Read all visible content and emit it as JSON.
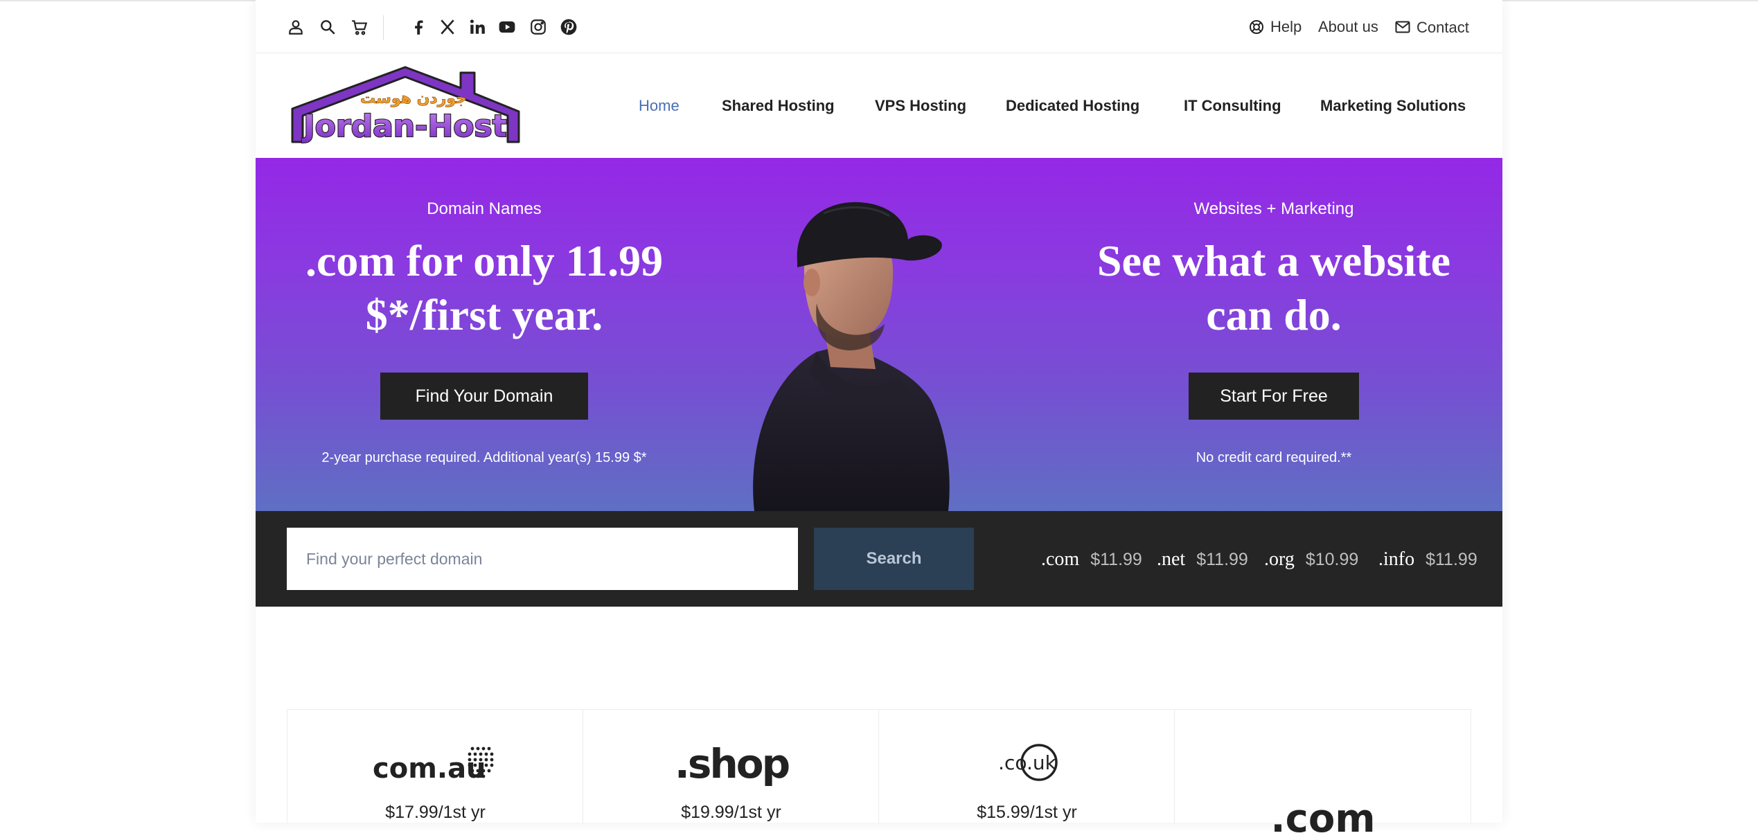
{
  "topbar": {
    "help": "Help",
    "about": "About us",
    "contact": "Contact"
  },
  "logo": {
    "arabic": "جوردن هوست",
    "name": "Jordan-Host"
  },
  "nav": {
    "home": "Home",
    "shared": "Shared Hosting",
    "vps": "VPS Hosting",
    "dedicated": "Dedicated Hosting",
    "consulting": "IT Consulting",
    "marketing": "Marketing Solutions"
  },
  "hero": {
    "left": {
      "eyebrow": "Domain Names",
      "title": ".com for only 11.99 $*/first year.",
      "button": "Find Your Domain",
      "note": "2-year purchase required. Additional year(s) 15.99 $*"
    },
    "right": {
      "eyebrow": "Websites + Marketing",
      "title": "See what a website can do.",
      "button": "Start For Free",
      "note": "No credit card required.**"
    }
  },
  "search": {
    "placeholder": "Find your perfect domain",
    "button": "Search",
    "tlds": [
      {
        "name": ".com",
        "price": "$11.99"
      },
      {
        "name": ".net",
        "price": "$11.99"
      },
      {
        "name": ".org",
        "price": "$10.99"
      },
      {
        "name": ".info",
        "price": "$11.99"
      }
    ]
  },
  "cards": [
    {
      "logo_text": "com.au",
      "price": "$17.99/1st yr"
    },
    {
      "logo_text": ".shop",
      "price": "$19.99/1st yr"
    },
    {
      "logo_text": ".co.uk",
      "price": "$15.99/1st yr"
    },
    {
      "logo_text": ".com",
      "price": ""
    }
  ],
  "colors": {
    "hero_top": "#9428e6",
    "hero_bottom": "#5f6fc3",
    "nav_active": "#4a6fb5",
    "dark_strip": "#252525",
    "search_button": "#2b3f55"
  },
  "icons": [
    "user-icon",
    "search-icon",
    "cart-icon",
    "facebook-icon",
    "x-icon",
    "linkedin-icon",
    "youtube-icon",
    "instagram-icon",
    "pinterest-icon",
    "lifebuoy-icon",
    "mail-icon"
  ]
}
